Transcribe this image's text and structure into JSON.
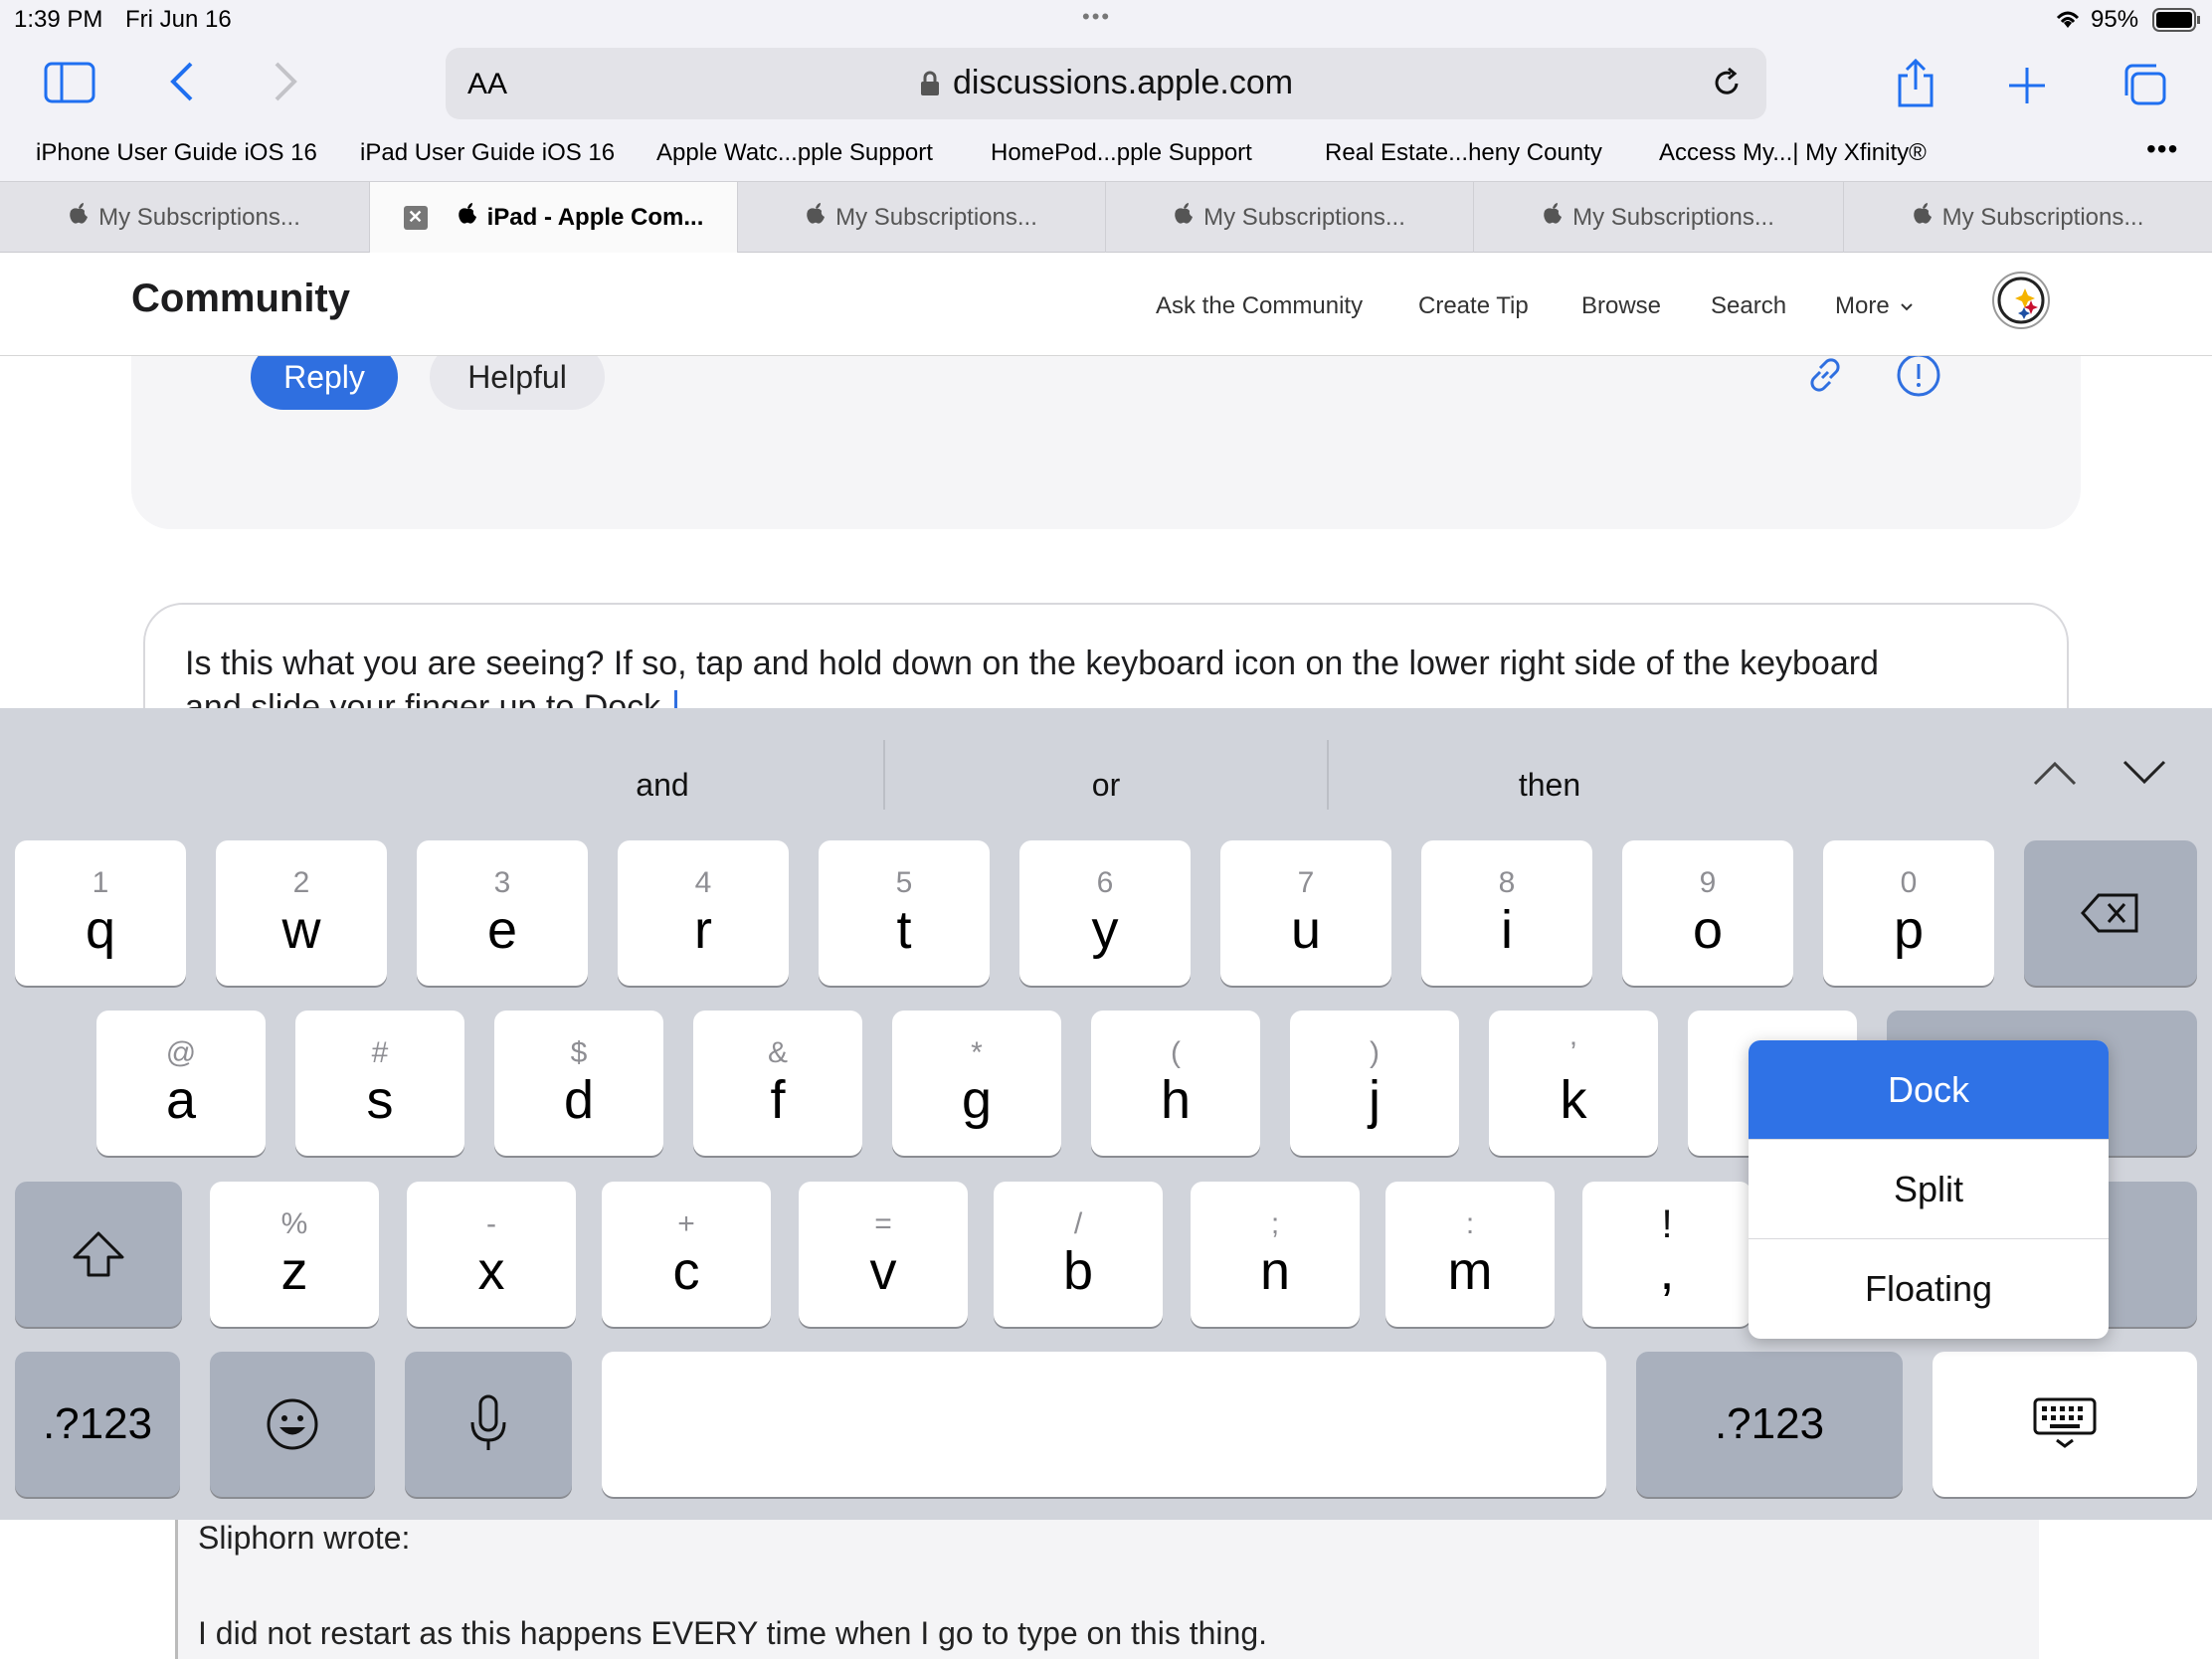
{
  "status": {
    "time": "1:39 PM",
    "date": "Fri Jun 16",
    "battery": "95%"
  },
  "browser": {
    "text_size": "AA",
    "url": "discussions.apple.com",
    "more_dots": "•••"
  },
  "bookmarks": [
    "iPhone User Guide iOS 16",
    "iPad User Guide iOS 16",
    "Apple Watc...pple Support",
    "HomePod...pple Support",
    "Real Estate...heny County",
    "Access My...| My Xfinity®"
  ],
  "tabs": [
    "My Subscriptions...",
    "iPad - Apple Com...",
    "My Subscriptions...",
    "My Subscriptions...",
    "My Subscriptions...",
    "My Subscriptions..."
  ],
  "community": {
    "title": "Community",
    "nav": [
      "Ask the Community",
      "Create Tip",
      "Browse",
      "Search",
      "More"
    ]
  },
  "post": {
    "reply": "Reply",
    "helpful": "Helpful"
  },
  "editor": {
    "text": "Is this what you are seeing? If so, tap and hold down on the keyboard icon on the lower right side of the keyboard",
    "text2": "and slide your finger up to Dock."
  },
  "keyboard": {
    "suggestions": [
      "and",
      "or",
      "then"
    ],
    "row1": [
      {
        "n": "1",
        "k": "q"
      },
      {
        "n": "2",
        "k": "w"
      },
      {
        "n": "3",
        "k": "e"
      },
      {
        "n": "4",
        "k": "r"
      },
      {
        "n": "5",
        "k": "t"
      },
      {
        "n": "6",
        "k": "y"
      },
      {
        "n": "7",
        "k": "u"
      },
      {
        "n": "8",
        "k": "i"
      },
      {
        "n": "9",
        "k": "o"
      },
      {
        "n": "0",
        "k": "p"
      }
    ],
    "row2": [
      {
        "n": "@",
        "k": "a"
      },
      {
        "n": "#",
        "k": "s"
      },
      {
        "n": "$",
        "k": "d"
      },
      {
        "n": "&",
        "k": "f"
      },
      {
        "n": "*",
        "k": "g"
      },
      {
        "n": "(",
        "k": "h"
      },
      {
        "n": ")",
        "k": "j"
      },
      {
        "n": "’",
        "k": "k"
      },
      {
        "n": "”",
        "k": ""
      }
    ],
    "row3": [
      {
        "n": "%",
        "k": "z"
      },
      {
        "n": "-",
        "k": "x"
      },
      {
        "n": "+",
        "k": "c"
      },
      {
        "n": "=",
        "k": "v"
      },
      {
        "n": "/",
        "k": "b"
      },
      {
        "n": ";",
        "k": "n"
      },
      {
        "n": ":",
        "k": "m"
      },
      {
        "n": "!",
        "k": ","
      }
    ],
    "numbers_left": ".?123",
    "numbers_right": ".?123"
  },
  "popup": {
    "items": [
      "Dock",
      "Split",
      "Floating"
    ],
    "selected": "Dock"
  },
  "quote": {
    "author": "Sliphorn wrote:",
    "text": "I did not restart as this happens EVERY time when I go to type on this thing."
  },
  "colors": {
    "accent": "#2f6fe0",
    "keyboard_bg": "#d1d4db"
  }
}
